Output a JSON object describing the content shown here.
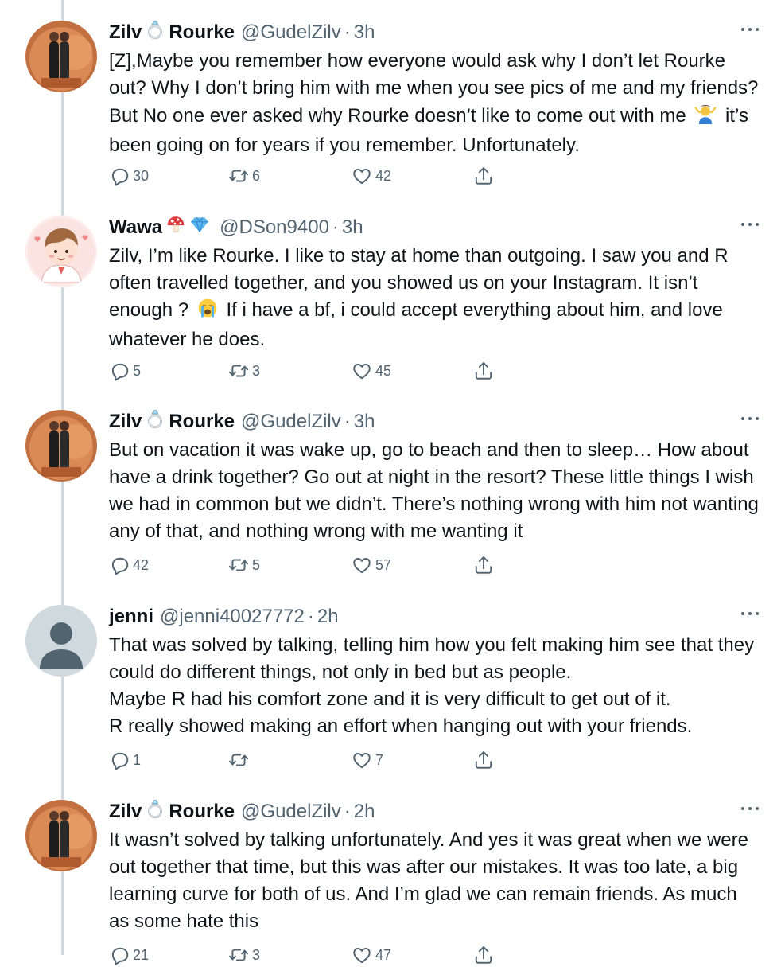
{
  "colors": {
    "text": "#0f1419",
    "secondary": "#536471",
    "thread_line": "#cfd9de"
  },
  "tweets": [
    {
      "name_first": "Zilv",
      "name_emoji": "ring-icon",
      "name_last": "Rourke",
      "handle": "@GudelZilv",
      "time": "3h",
      "text_before": "[Z],Maybe you remember how everyone would ask why I don’t let Rourke out? Why I don’t bring him with me when you see pics of me and my friends? But No one ever asked why Rourke doesn’t like to come out with me",
      "inline_emoji": "person-shrugging-icon",
      "text_after": "it’s been going on for years if you remember. Unfortunately.",
      "replies": "30",
      "retweets": "6",
      "likes": "42"
    },
    {
      "name": "Wawa",
      "name_emojis": [
        "mushroom-icon",
        "gem-icon"
      ],
      "handle": "@DSon9400",
      "time": "3h",
      "text_before": "Zilv, I’m like Rourke. I like to stay at home than outgoing. I saw you and R often travelled together, and you showed us on your Instagram. It isn’t enough ?",
      "inline_emoji": "crying-face-icon",
      "text_after": "If i have a bf, i could accept everything about him, and love whatever he does.",
      "replies": "5",
      "retweets": "3",
      "likes": "45"
    },
    {
      "name_first": "Zilv",
      "name_emoji": "ring-icon",
      "name_last": "Rourke",
      "handle": "@GudelZilv",
      "time": "3h",
      "text": "But on vacation it was wake up, go to beach and then to sleep… How about have a drink together? Go out at night in the resort? These little things I wish we had in common but we didn’t. There’s nothing wrong with him not wanting any of that, and nothing wrong with me wanting it",
      "replies": "42",
      "retweets": "5",
      "likes": "57"
    },
    {
      "name": "jenni",
      "handle": "@jenni40027772",
      "time": "2h",
      "lines": [
        "That was solved by talking, telling him how you felt making him see that they could do different things, not only in bed but as people.",
        "Maybe R had his comfort zone and it is very difficult to get out of it.",
        "R really showed making an effort when hanging out with your friends."
      ],
      "replies": "1",
      "retweets": "",
      "likes": "7"
    },
    {
      "name_first": "Zilv",
      "name_emoji": "ring-icon",
      "name_last": "Rourke",
      "handle": "@GudelZilv",
      "time": "2h",
      "text": "It wasn’t solved by talking unfortunately. And yes it was great when we were out together that time, but this was after our mistakes. It was too late, a big learning curve for both of us. And I’m glad we can remain friends. As much as some hate this",
      "replies": "21",
      "retweets": "3",
      "likes": "47"
    }
  ]
}
